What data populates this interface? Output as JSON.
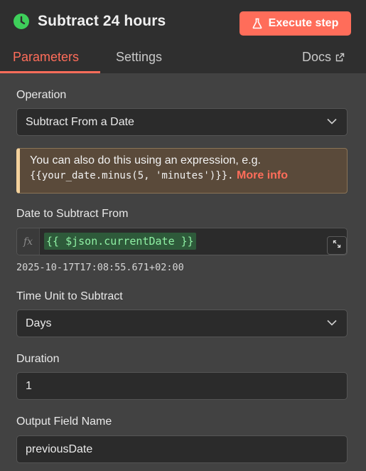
{
  "header": {
    "title": "Subtract 24 hours",
    "status_icon": "clock-icon",
    "execute_label": "Execute step",
    "tabs": [
      {
        "label": "Parameters",
        "active": true
      },
      {
        "label": "Settings",
        "active": false
      }
    ],
    "docs_label": "Docs"
  },
  "colors": {
    "accent": "#ff6d5a",
    "status_green": "#3ecf5a",
    "expression_bg": "#2e5a3a",
    "expression_text": "#8ff0a4",
    "notice_border": "#f3d19c"
  },
  "operation": {
    "label": "Operation",
    "value": "Subtract From a Date"
  },
  "notice": {
    "text": "You can also do this using an expression, e.g.",
    "code": "{{your_date.minus(5, 'minutes')}}.",
    "link": "More info"
  },
  "date_field": {
    "label": "Date to Subtract From",
    "fx": "fx",
    "expression": "{{ $json.currentDate }}",
    "result": "2025-10-17T17:08:55.671+02:00"
  },
  "time_unit": {
    "label": "Time Unit to Subtract",
    "value": "Days"
  },
  "duration": {
    "label": "Duration",
    "value": "1"
  },
  "output_field": {
    "label": "Output Field Name",
    "value": "previousDate"
  }
}
